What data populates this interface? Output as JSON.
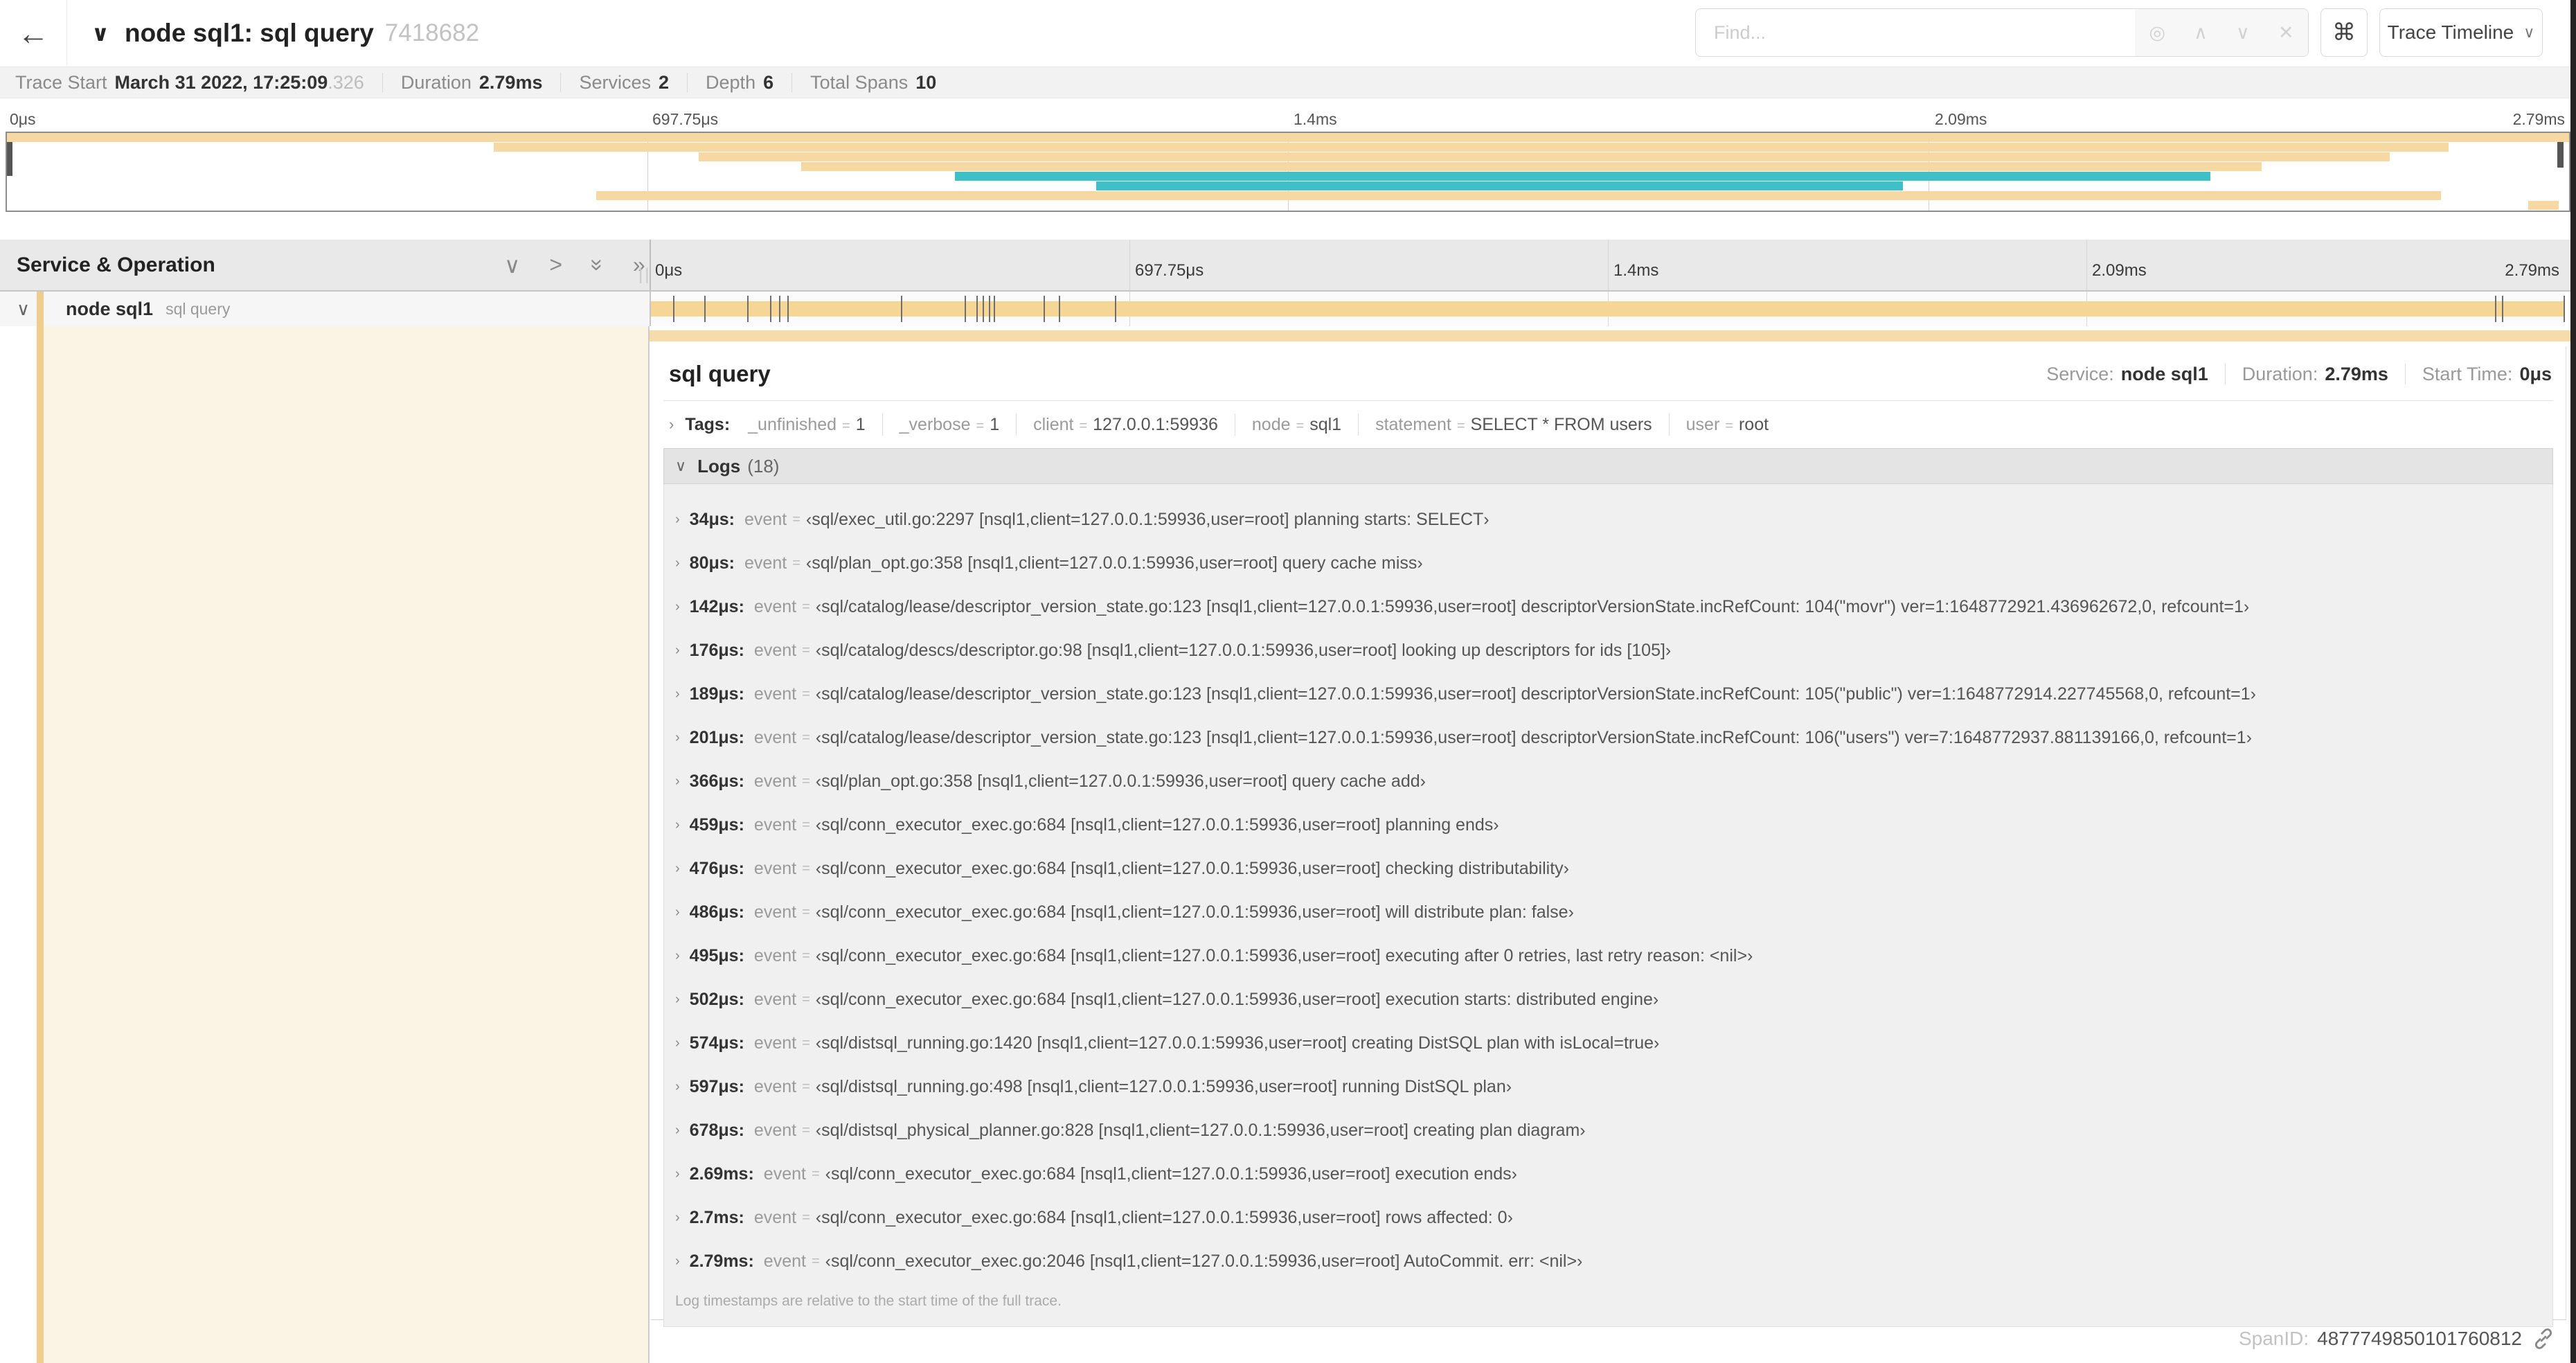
{
  "colors": {
    "minimap_tan": "#f6d9a2",
    "span_tan": "#f6d695",
    "accent_tan": "#f6dca8",
    "stripe_tan": "#efcе8d",
    "stripe": "#efce8d",
    "teal": "#3fc0c6",
    "cream": "#faf4e4"
  },
  "icons": {
    "back": "←",
    "chevron_down": "∨",
    "chevron_right": "›",
    "chevron_right_big": ">",
    "double_chevron": "»",
    "target": "◎",
    "up": "∧",
    "down": "∨",
    "close": "✕",
    "cmd": "⌘",
    "grip": "||"
  },
  "topbar": {
    "title": "node sql1: sql query",
    "trace_id": "7418682",
    "find_placeholder": "Find...",
    "view_selector": "Trace Timeline"
  },
  "infobar": {
    "items": [
      {
        "label": "Trace Start",
        "value": "March 31 2022, 17:25:09",
        "muted": ".326"
      },
      {
        "label": "Duration",
        "value": "2.79ms"
      },
      {
        "label": "Services",
        "value": "2"
      },
      {
        "label": "Depth",
        "value": "6"
      },
      {
        "label": "Total Spans",
        "value": "10"
      }
    ]
  },
  "timeline": {
    "ticks": [
      "0μs",
      "697.75μs",
      "1.4ms",
      "2.09ms",
      "2.79ms"
    ],
    "duration_us": 2790,
    "minimap_bars": [
      {
        "color": "tan",
        "from": 0,
        "to": 100
      },
      {
        "color": "tan",
        "from": 19,
        "to": 95.3
      },
      {
        "color": "tan",
        "from": 27,
        "to": 93
      },
      {
        "color": "tan",
        "from": 31,
        "to": 88
      },
      {
        "color": "teal",
        "from": 37,
        "to": 86
      },
      {
        "color": "teal",
        "from": 42.5,
        "to": 74
      },
      {
        "color": "tan",
        "from": 23,
        "to": 95
      },
      {
        "color": "tan",
        "from": 98.4,
        "to": 99.6
      }
    ]
  },
  "left_panel": {
    "header": "Service & Operation",
    "row_service": "node sql1",
    "row_operation": "sql query"
  },
  "detail": {
    "title": "sql query",
    "service_label": "Service:",
    "service": "node sql1",
    "duration_label": "Duration:",
    "duration": "2.79ms",
    "start_label": "Start Time:",
    "start": "0μs",
    "tags_label": "Tags:",
    "tags": [
      {
        "key": "_unfinished",
        "value": "1"
      },
      {
        "key": "_verbose",
        "value": "1"
      },
      {
        "key": "client",
        "value": "127.0.0.1:59936"
      },
      {
        "key": "node",
        "value": "sql1"
      },
      {
        "key": "statement",
        "value": "SELECT * FROM users"
      },
      {
        "key": "user",
        "value": "root"
      }
    ],
    "logs_label": "Logs",
    "logs_count": "(18)",
    "log_field": "event",
    "logs": [
      {
        "time": "34μs:",
        "t_us": 34,
        "value": "‹sql/exec_util.go:2297 [nsql1,client=127.0.0.1:59936,user=root] planning starts: SELECT›"
      },
      {
        "time": "80μs:",
        "t_us": 80,
        "value": "‹sql/plan_opt.go:358 [nsql1,client=127.0.0.1:59936,user=root] query cache miss›"
      },
      {
        "time": "142μs:",
        "t_us": 142,
        "value": "‹sql/catalog/lease/descriptor_version_state.go:123 [nsql1,client=127.0.0.1:59936,user=root] descriptorVersionState.incRefCount: 104(\"movr\") ver=1:1648772921.436962672,0, refcount=1›"
      },
      {
        "time": "176μs:",
        "t_us": 176,
        "value": "‹sql/catalog/descs/descriptor.go:98 [nsql1,client=127.0.0.1:59936,user=root] looking up descriptors for ids [105]›"
      },
      {
        "time": "189μs:",
        "t_us": 189,
        "value": "‹sql/catalog/lease/descriptor_version_state.go:123 [nsql1,client=127.0.0.1:59936,user=root] descriptorVersionState.incRefCount: 105(\"public\") ver=1:1648772914.227745568,0, refcount=1›"
      },
      {
        "time": "201μs:",
        "t_us": 201,
        "value": "‹sql/catalog/lease/descriptor_version_state.go:123 [nsql1,client=127.0.0.1:59936,user=root] descriptorVersionState.incRefCount: 106(\"users\") ver=7:1648772937.881139166,0, refcount=1›"
      },
      {
        "time": "366μs:",
        "t_us": 366,
        "value": "‹sql/plan_opt.go:358 [nsql1,client=127.0.0.1:59936,user=root] query cache add›"
      },
      {
        "time": "459μs:",
        "t_us": 459,
        "value": "‹sql/conn_executor_exec.go:684 [nsql1,client=127.0.0.1:59936,user=root] planning ends›"
      },
      {
        "time": "476μs:",
        "t_us": 476,
        "value": "‹sql/conn_executor_exec.go:684 [nsql1,client=127.0.0.1:59936,user=root] checking distributability›"
      },
      {
        "time": "486μs:",
        "t_us": 486,
        "value": "‹sql/conn_executor_exec.go:684 [nsql1,client=127.0.0.1:59936,user=root] will distribute plan: false›"
      },
      {
        "time": "495μs:",
        "t_us": 495,
        "value": "‹sql/conn_executor_exec.go:684 [nsql1,client=127.0.0.1:59936,user=root] executing after 0 retries, last retry reason: <nil>›"
      },
      {
        "time": "502μs:",
        "t_us": 502,
        "value": "‹sql/conn_executor_exec.go:684 [nsql1,client=127.0.0.1:59936,user=root] execution starts: distributed engine›"
      },
      {
        "time": "574μs:",
        "t_us": 574,
        "value": "‹sql/distsql_running.go:1420 [nsql1,client=127.0.0.1:59936,user=root] creating DistSQL plan with isLocal=true›"
      },
      {
        "time": "597μs:",
        "t_us": 597,
        "value": "‹sql/distsql_running.go:498 [nsql1,client=127.0.0.1:59936,user=root] running DistSQL plan›"
      },
      {
        "time": "678μs:",
        "t_us": 678,
        "value": "‹sql/distsql_physical_planner.go:828 [nsql1,client=127.0.0.1:59936,user=root] creating plan diagram›"
      },
      {
        "time": "2.69ms:",
        "t_us": 2690,
        "value": "‹sql/conn_executor_exec.go:684 [nsql1,client=127.0.0.1:59936,user=root] execution ends›"
      },
      {
        "time": "2.7ms:",
        "t_us": 2700,
        "value": "‹sql/conn_executor_exec.go:684 [nsql1,client=127.0.0.1:59936,user=root] rows affected: 0›"
      },
      {
        "time": "2.79ms:",
        "t_us": 2790,
        "value": "‹sql/conn_executor_exec.go:2046 [nsql1,client=127.0.0.1:59936,user=root] AutoCommit. err: <nil>›"
      }
    ],
    "footer": "Log timestamps are relative to the start time of the full trace.",
    "spanid_label": "SpanID:",
    "spanid": "4877749850101760812"
  }
}
